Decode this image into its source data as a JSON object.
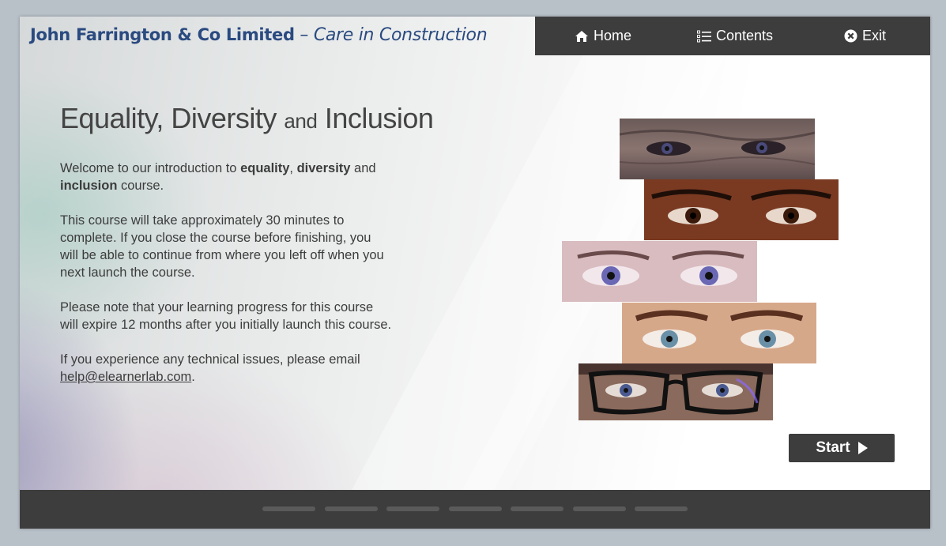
{
  "header": {
    "company": "John Farrington & Co Limited",
    "dash": " – ",
    "tagline": "Care in Construction"
  },
  "nav": {
    "home_label": "Home",
    "contents_label": "Contents",
    "exit_label": "Exit"
  },
  "main": {
    "title_part1": "Equality, Diversity ",
    "title_part2": "and",
    "title_part3": " Inclusion",
    "intro_1": "Welcome to our introduction to ",
    "intro_equality": "equality",
    "intro_2": ", ",
    "intro_diversity": "diversity",
    "intro_3": " and ",
    "intro_inclusion": "inclusion",
    "intro_4": " course.",
    "para_duration": "This course will take approximately 30 minutes to complete. If you close the course before finishing, you will be able to continue from where you left off when you next launch the course.",
    "para_expiry": "Please note that your learning progress for this course will expire 12 months after you initially launch this course.",
    "para_support": "If you experience any technical issues, please email",
    "support_email": "help@elearnerlab.com",
    "support_end": "."
  },
  "start_button": {
    "label": "Start"
  },
  "colors": {
    "brand_blue": "#2a4a80",
    "nav_bg": "#3d3d3d",
    "footer_bg": "#3d3d3d",
    "text": "#3c3c3c"
  },
  "icons": {
    "home": "home-icon",
    "contents": "list-icon",
    "exit": "close-circle-icon",
    "start": "play-arrow-icon"
  },
  "footer": {
    "progress_segments": 7
  }
}
